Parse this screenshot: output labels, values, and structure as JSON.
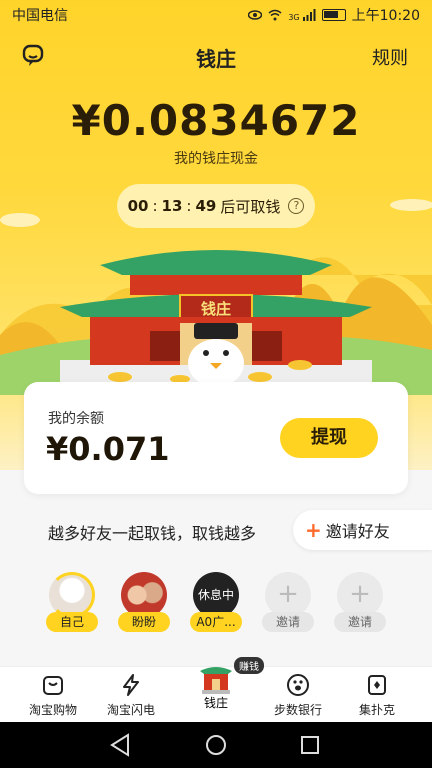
{
  "status": {
    "carrier": "中国电信",
    "time": "上午10:20",
    "signal": "3G"
  },
  "appbar": {
    "title": "钱庄",
    "rules": "规则"
  },
  "vault": {
    "amount": "¥0.0834672",
    "label": "我的钱庄现金"
  },
  "timer": {
    "h": "00",
    "m": "13",
    "s": "49",
    "suffix": "后可取钱",
    "help": "?"
  },
  "building": {
    "sign": "钱庄"
  },
  "balance": {
    "label": "我的余额",
    "value": "¥0.071",
    "withdraw": "提现"
  },
  "invite": {
    "text": "越多好友一起取钱，取钱越多",
    "button": "邀请好友",
    "plus": "+"
  },
  "friends": [
    {
      "name": "自己"
    },
    {
      "name": "盼盼"
    },
    {
      "name": "A0广...",
      "status": "休息中"
    },
    {
      "name": "邀请",
      "add": "+"
    },
    {
      "name": "邀请",
      "add": "+"
    }
  ],
  "tabs": [
    {
      "label": "淘宝购物"
    },
    {
      "label": "淘宝闪电"
    },
    {
      "label": "钱庄",
      "badge": "赚钱"
    },
    {
      "label": "步数银行"
    },
    {
      "label": "集扑克"
    }
  ],
  "colors": {
    "accent": "#ffd31f",
    "bg": "#ffd42a",
    "text": "#2b1e08"
  }
}
